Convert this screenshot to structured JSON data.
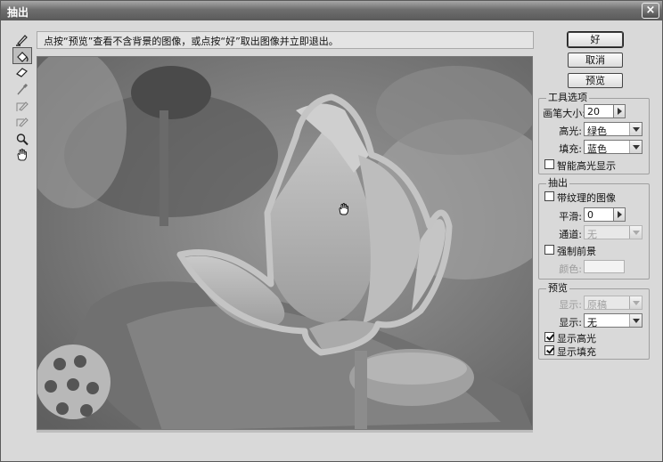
{
  "window": {
    "title": "抽出",
    "close_glyph": "×"
  },
  "hint": "点按“预览”查看不含背景的图像，或点按“好”取出图像并立即退出。",
  "tools": [
    {
      "name": "edge-highlighter-icon"
    },
    {
      "name": "fill-tool-icon"
    },
    {
      "name": "eraser-icon"
    },
    {
      "name": "eyedropper-icon"
    },
    {
      "name": "cleanup-tool-icon"
    },
    {
      "name": "edge-touchup-icon"
    },
    {
      "name": "zoom-icon"
    },
    {
      "name": "hand-icon"
    }
  ],
  "buttons": {
    "ok": "好",
    "cancel": "取消",
    "preview": "预览"
  },
  "tool_options": {
    "title": "工具选项",
    "brush_size_label": "画笔大小:",
    "brush_size_value": "20",
    "highlight_label": "高光:",
    "highlight_value": "绿色",
    "fill_label": "填充:",
    "fill_value": "蓝色",
    "smart_highlight_label": "智能高光显示",
    "smart_highlight_checked": false
  },
  "extraction": {
    "title": "抽出",
    "textured_image_label": "带纹理的图像",
    "textured_image_checked": false,
    "smooth_label": "平滑:",
    "smooth_value": "0",
    "channel_label": "通道:",
    "channel_value": "无",
    "force_foreground_label": "强制前景",
    "force_foreground_checked": false,
    "color_label": "颜色:"
  },
  "preview_group": {
    "title": "预览",
    "show_label": "显示:",
    "show_value": "原稿",
    "display_label": "显示:",
    "display_value": "无",
    "show_highlight_label": "显示高光",
    "show_highlight_checked": true,
    "show_fill_label": "显示填充",
    "show_fill_checked": true
  },
  "colors": {
    "highlight_outline": "#c4c4c4",
    "titlebar": "#6e6e6e",
    "panel": "#d9d9d9"
  }
}
